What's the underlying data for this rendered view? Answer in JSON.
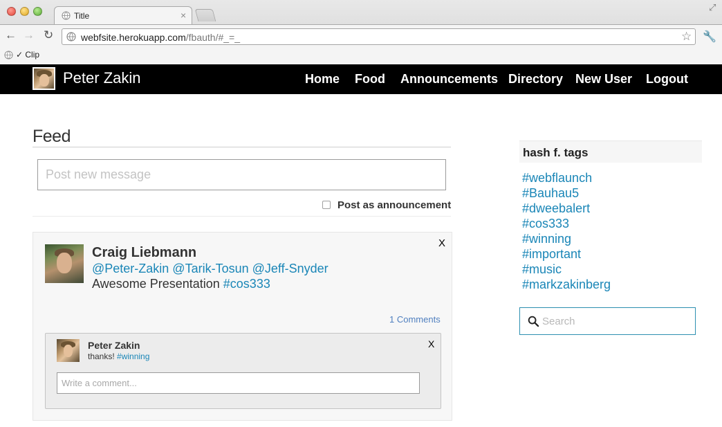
{
  "browser": {
    "tab_title": "Title",
    "tab_close": "×",
    "url_host": "webfsite.herokuapp.com",
    "url_path": "/fbauth/#_=_",
    "bookmark_label": "✓ Clip"
  },
  "navbar": {
    "brand": "Peter Zakin",
    "links": [
      "Home",
      "Food",
      "Announcements",
      "Directory",
      "New User",
      "Logout"
    ]
  },
  "feed": {
    "title": "Feed",
    "post_placeholder": "Post new message",
    "announcement_label": "Post as announcement",
    "posts": [
      {
        "author": "Craig Liebmann",
        "mentions": "@Peter-Zakin @Tarik-Tosun @Jeff-Snyder",
        "body_text": "Awesome Presentation ",
        "body_tag": "#cos333",
        "delete_label": "X",
        "comments_link": "1 Comments",
        "comments": [
          {
            "author": "Peter Zakin",
            "text": "thanks! ",
            "tag": "#winning",
            "delete_label": "X"
          }
        ],
        "comment_placeholder": "Write a comment..."
      }
    ]
  },
  "sidebar": {
    "hash_title": "hash f. tags",
    "tags": [
      "#webflaunch",
      "#Bauhau5",
      "#dweebalert",
      "#cos333",
      "#winning",
      "#important",
      "#music",
      "#markzakinberg"
    ],
    "search_placeholder": "Search"
  },
  "colors": {
    "link": "#1a86b7",
    "navbar_bg": "#000000",
    "search_border": "#2c8fb0"
  }
}
